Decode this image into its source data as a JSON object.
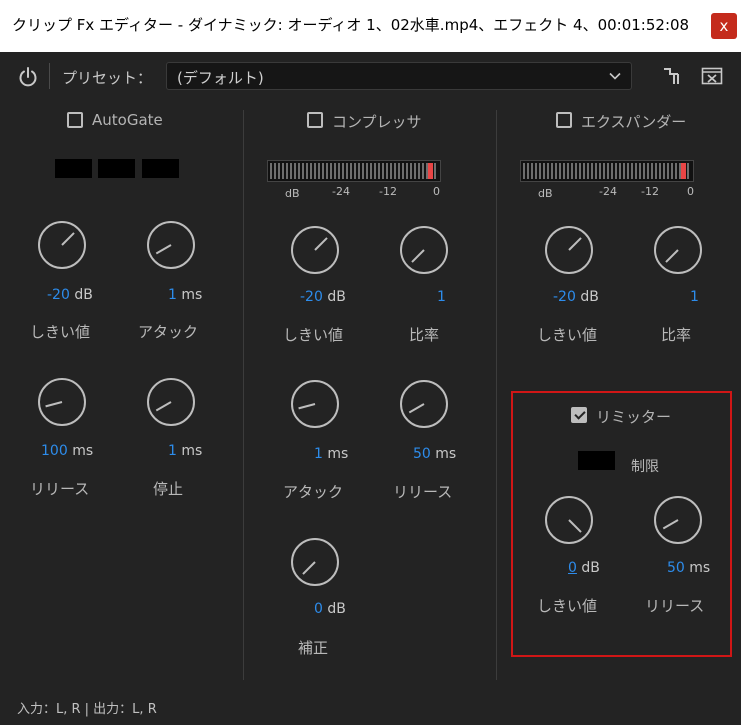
{
  "window": {
    "title": "クリップ Fx エディター - ダイナミック: オーディオ 1、02水車.mp4、エフェクト 4、00:01:52:08",
    "close_glyph": "x"
  },
  "toolbar": {
    "preset_label": "プリセット：",
    "preset_value": "(デフォルト)"
  },
  "autogate": {
    "label": "AutoGate",
    "checked": false,
    "threshold": {
      "value": "-20",
      "unit": "dB",
      "label": "しきい値"
    },
    "attack": {
      "value": "1",
      "unit": "ms",
      "label": "アタック"
    },
    "release": {
      "value": "100",
      "unit": "ms",
      "label": "リリース"
    },
    "hold": {
      "value": "1",
      "unit": "ms",
      "label": "停止"
    }
  },
  "compressor": {
    "label": "コンプレッサ",
    "checked": false,
    "meter_scale": [
      "dB",
      "-24",
      "-12",
      "0"
    ],
    "threshold": {
      "value": "-20",
      "unit": "dB",
      "label": "しきい値"
    },
    "ratio": {
      "value": "1",
      "unit": "",
      "label": "比率"
    },
    "attack": {
      "value": "1",
      "unit": "ms",
      "label": "アタック"
    },
    "release": {
      "value": "50",
      "unit": "ms",
      "label": "リリース"
    },
    "makeup": {
      "value": "0",
      "unit": "dB",
      "label": "補正"
    }
  },
  "expander": {
    "label": "エクスパンダー",
    "checked": false,
    "meter_scale": [
      "dB",
      "-24",
      "-12",
      "0"
    ],
    "threshold": {
      "value": "-20",
      "unit": "dB",
      "label": "しきい値"
    },
    "ratio": {
      "value": "1",
      "unit": "",
      "label": "比率"
    }
  },
  "limiter": {
    "label": "リミッター",
    "checked": true,
    "indicator_label": "制限",
    "threshold": {
      "value": "0",
      "unit": "dB",
      "label": "しきい値"
    },
    "release": {
      "value": "50",
      "unit": "ms",
      "label": "リリース"
    }
  },
  "footer": {
    "io_text": "入力：L, R | 出力：L, R"
  },
  "colors": {
    "value_blue": "#2d8ceb",
    "highlight_red": "#d01616",
    "meter_peak": "#e84545",
    "close_red": "#c42b1c"
  },
  "icons": [
    "power-icon",
    "chevron-down-icon",
    "routing-icon",
    "clear-icon"
  ]
}
